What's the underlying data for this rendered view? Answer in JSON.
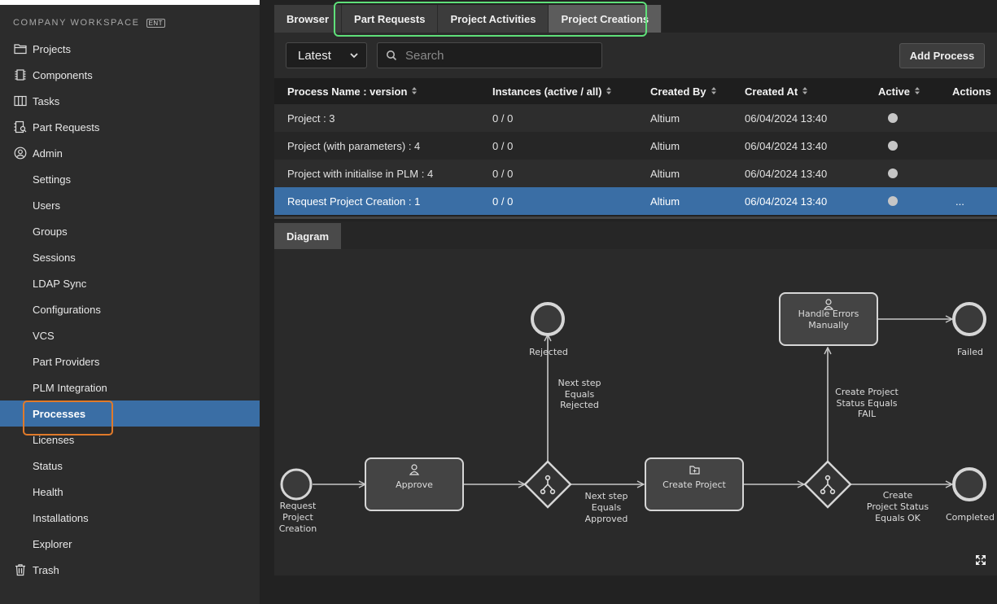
{
  "sidebar": {
    "workspace_label": "COMPANY WORKSPACE",
    "workspace_badge": "ENT",
    "items": [
      {
        "label": "Projects",
        "icon": "folder-icon",
        "level": "top"
      },
      {
        "label": "Components",
        "icon": "chip-icon",
        "level": "top"
      },
      {
        "label": "Tasks",
        "icon": "board-icon",
        "level": "top"
      },
      {
        "label": "Part Requests",
        "icon": "part-request-icon",
        "level": "top"
      },
      {
        "label": "Admin",
        "icon": "user-circle-icon",
        "level": "top"
      },
      {
        "label": "Settings",
        "level": "sub"
      },
      {
        "label": "Users",
        "level": "sub"
      },
      {
        "label": "Groups",
        "level": "sub"
      },
      {
        "label": "Sessions",
        "level": "sub"
      },
      {
        "label": "LDAP Sync",
        "level": "sub"
      },
      {
        "label": "Configurations",
        "level": "sub"
      },
      {
        "label": "VCS",
        "level": "sub"
      },
      {
        "label": "Part Providers",
        "level": "sub"
      },
      {
        "label": "PLM Integration",
        "level": "sub"
      },
      {
        "label": "Processes",
        "level": "sub",
        "active": true
      },
      {
        "label": "Licenses",
        "level": "sub"
      },
      {
        "label": "Status",
        "level": "sub"
      },
      {
        "label": "Health",
        "level": "sub"
      },
      {
        "label": "Installations",
        "level": "sub"
      },
      {
        "label": "Explorer",
        "level": "sub"
      },
      {
        "label": "Trash",
        "icon": "trash-icon",
        "level": "top"
      }
    ]
  },
  "tabs": [
    {
      "label": "Browser"
    },
    {
      "label": "Part Requests"
    },
    {
      "label": "Project Activities"
    },
    {
      "label": "Project Creations",
      "selected": true
    }
  ],
  "toolbar": {
    "version_select": "Latest",
    "search_placeholder": "Search",
    "add_button": "Add Process"
  },
  "table": {
    "columns": [
      "Process Name : version",
      "Instances (active / all)",
      "Created By",
      "Created At",
      "Active",
      "Actions"
    ],
    "rows": [
      {
        "name": "Project : 3",
        "instances": "0 / 0",
        "created_by": "Altium",
        "created_at": "06/04/2024 13:40",
        "actions": ""
      },
      {
        "name": "Project (with parameters) : 4",
        "instances": "0 / 0",
        "created_by": "Altium",
        "created_at": "06/04/2024 13:40",
        "actions": ""
      },
      {
        "name": "Project with initialise in PLM : 4",
        "instances": "0 / 0",
        "created_by": "Altium",
        "created_at": "06/04/2024 13:40",
        "actions": ""
      },
      {
        "name": "Request Project Creation : 1",
        "instances": "0 / 0",
        "created_by": "Altium",
        "created_at": "06/04/2024 13:40",
        "actions": "...",
        "selected": true
      }
    ]
  },
  "diagram_tab": "Diagram",
  "diagram": {
    "start": [
      "Request",
      "Project",
      "Creation"
    ],
    "approve": "Approve",
    "create_project": "Create Project",
    "handle_errors": [
      "Handle Errors",
      "Manually"
    ],
    "rejected": "Rejected",
    "failed": "Failed",
    "completed": "Completed",
    "edge_rejected": [
      "Next step",
      "Equals",
      "Rejected"
    ],
    "edge_approved": [
      "Next step",
      "Equals",
      "Approved"
    ],
    "edge_fail": [
      "Create Project",
      "Status Equals",
      "FAIL"
    ],
    "edge_ok": [
      "Create",
      "Project Status",
      "Equals OK"
    ]
  }
}
